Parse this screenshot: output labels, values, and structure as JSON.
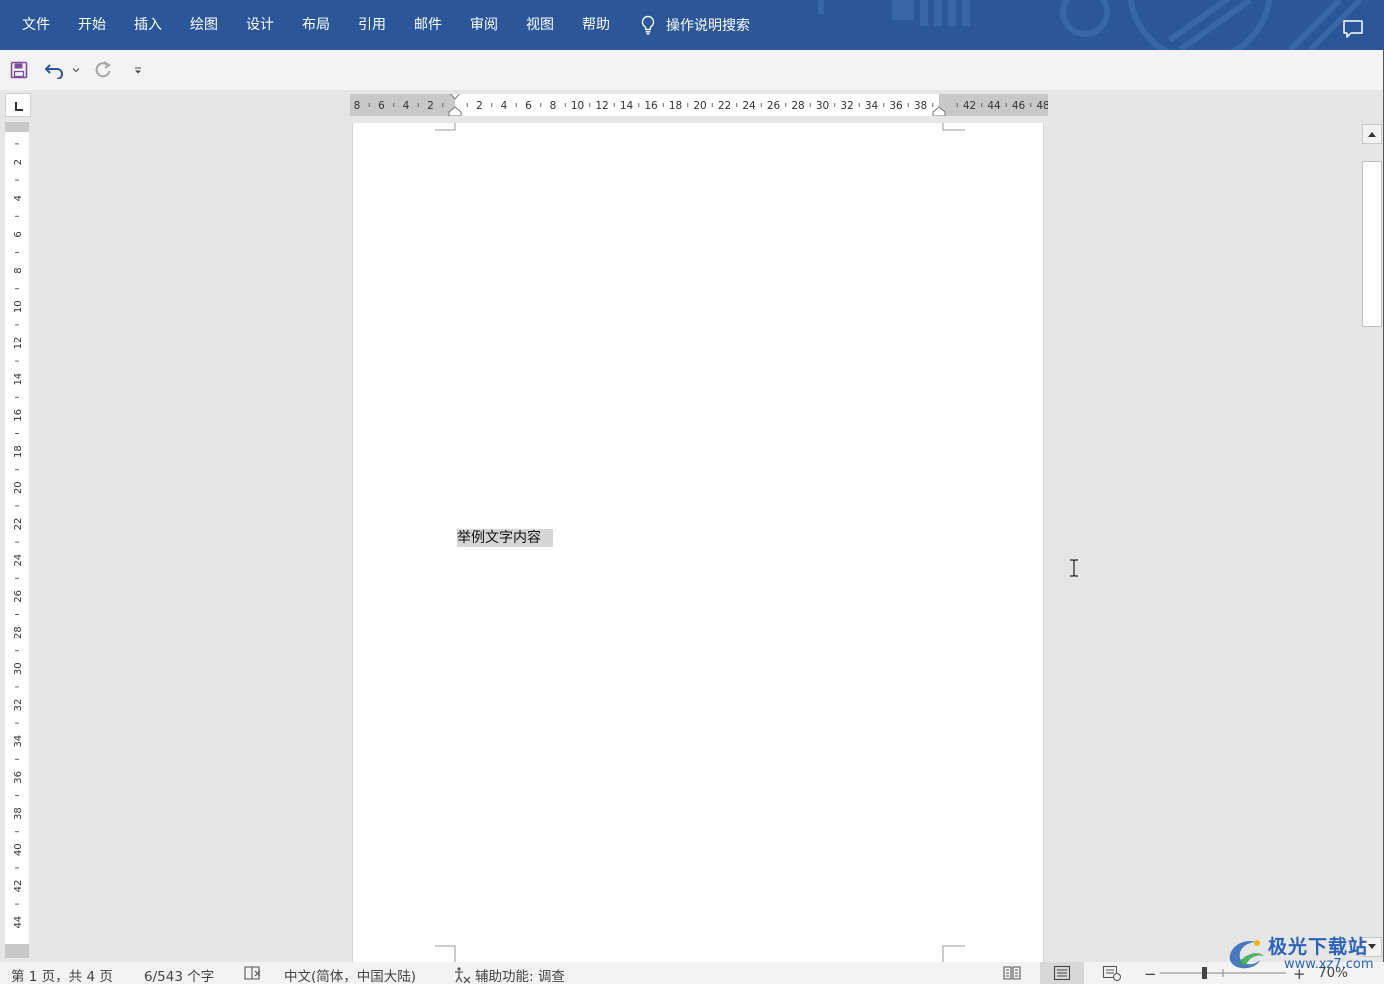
{
  "ribbon": {
    "tabs": [
      "文件",
      "开始",
      "插入",
      "绘图",
      "设计",
      "布局",
      "引用",
      "邮件",
      "审阅",
      "视图",
      "帮助"
    ],
    "tell_me": "操作说明搜索",
    "icons": {
      "tell_me": "lightbulb-icon",
      "comments": "comment-icon"
    },
    "colors": {
      "ribbon_bg": "#2b579a",
      "accent": "#2b579a"
    }
  },
  "qat": {
    "icons": [
      "save-icon",
      "undo-icon",
      "undo-dropdown-icon",
      "redo-icon",
      "customize-qat-icon"
    ]
  },
  "ruler": {
    "h_left_labels": [
      "8",
      "6",
      "4",
      "2"
    ],
    "h_main_labels": [
      "2",
      "4",
      "6",
      "8",
      "10",
      "12",
      "14",
      "16",
      "18",
      "20",
      "22",
      "24",
      "26",
      "28",
      "30",
      "32",
      "34",
      "36",
      "38"
    ],
    "h_right_labels": [
      "42",
      "44",
      "46",
      "48"
    ],
    "v_labels": [
      "2",
      "4",
      "6",
      "8",
      "10",
      "12",
      "14",
      "16",
      "18",
      "20",
      "22",
      "24",
      "26",
      "28",
      "30",
      "32",
      "34",
      "36",
      "38",
      "40",
      "42",
      "44"
    ]
  },
  "document": {
    "text": "举例文字内容"
  },
  "status": {
    "page": "第 1 页，共 4 页",
    "words": "6/543 个字",
    "language": "中文(简体，中国大陆)",
    "accessibility": "辅助功能: 调查",
    "zoom_minus": "−",
    "zoom_plus": "+",
    "zoom_level": "70%"
  },
  "watermark": {
    "text": "极光下载站",
    "url": "www.xz7.com"
  }
}
